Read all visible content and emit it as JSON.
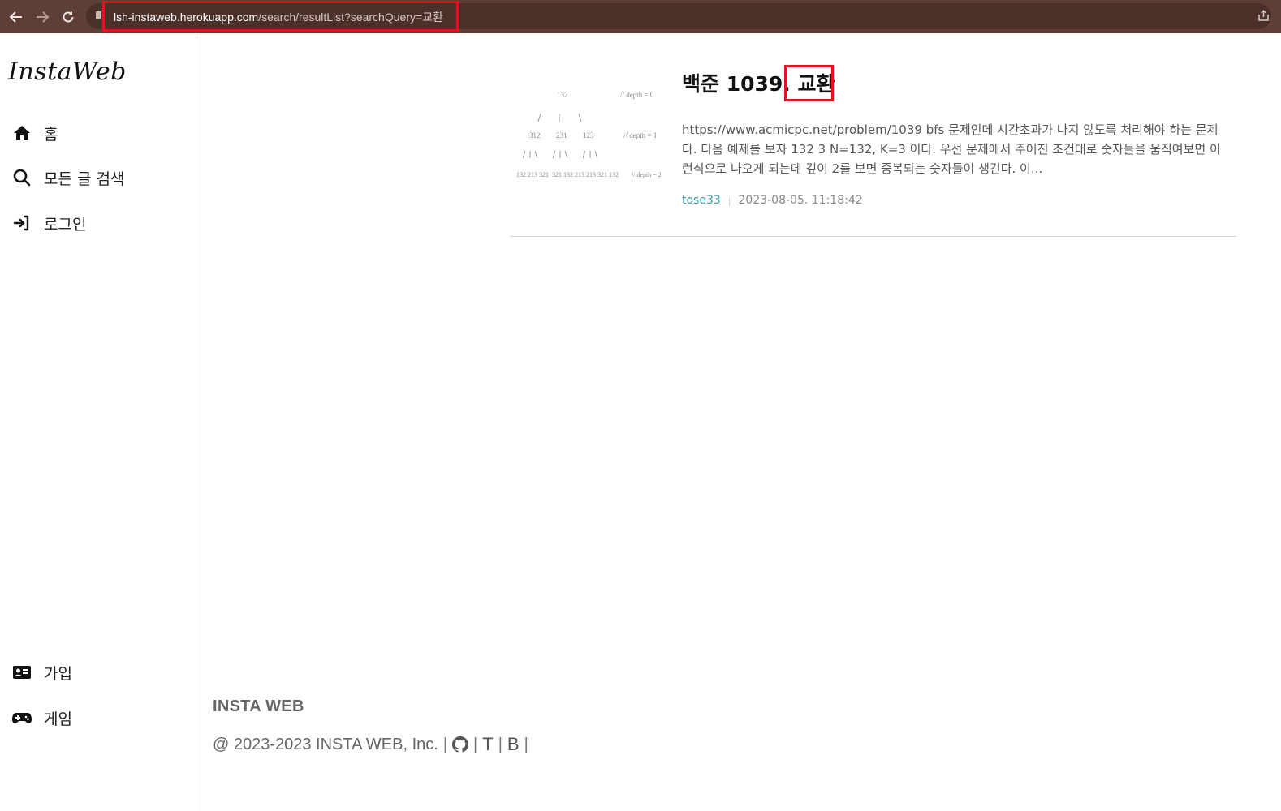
{
  "browser": {
    "url_host": "lsh-instaweb.herokuapp.com",
    "url_path": "/search/resultList?searchQuery=교환"
  },
  "sidebar": {
    "logo": "InstaWeb",
    "top_items": [
      {
        "label": "홈",
        "icon": "home-icon"
      },
      {
        "label": "모든 글 검색",
        "icon": "search-icon"
      },
      {
        "label": "로그인",
        "icon": "login-icon"
      }
    ],
    "bottom_items": [
      {
        "label": "가입",
        "icon": "id-card-icon"
      },
      {
        "label": "게임",
        "icon": "gamepad-icon"
      }
    ]
  },
  "results": [
    {
      "title_prefix": "백준 1039.",
      "title_highlight": "교환",
      "excerpt": "https://www.acmicpc.net/problem/1039 bfs 문제인데 시간초과가 나지 않도록 처리해야 하는 문제다. 다음 예제를 보자     132 3 N=132, K=3 이다. 우선 문제에서 주어진 조건대로 숫자들을 움직여보면     이런식으로 나오게 되는데 깊이 2를 보면 중복되는 숫자들이 생긴다.  이...",
      "author": "tose33",
      "date": "2023-08-05. 11:18:42",
      "thumbnail": {
        "root": "132",
        "level1": [
          "312",
          "231",
          "123"
        ],
        "level2": [
          "132 213 321",
          "321 132 213",
          "213 321 132"
        ],
        "depth_labels": [
          "// depth = 0",
          "// depth = 1",
          "// depth = 2"
        ]
      }
    }
  ],
  "footer": {
    "brand": "INSTA WEB",
    "copyright": "@ 2023-2023 INSTA WEB, Inc.",
    "link_t": "T",
    "link_b": "B"
  },
  "colors": {
    "chrome": "#5e3f38",
    "highlight_border": "#e0141e",
    "author": "#3aa0a8"
  }
}
